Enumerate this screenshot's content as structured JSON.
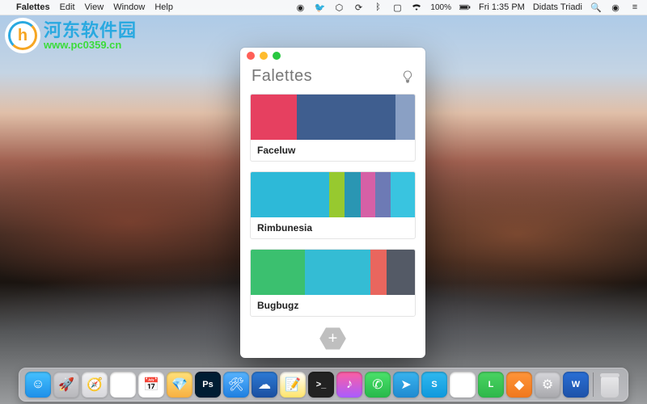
{
  "menubar": {
    "apple": "",
    "appname": "Falettes",
    "items": [
      "Edit",
      "View",
      "Window",
      "Help"
    ],
    "battery": "100%",
    "clock": "Fri 1:35 PM",
    "user": "Didats Triadi"
  },
  "watermark": {
    "logo_letter": "h",
    "cn": "河东软件园",
    "url": "www.pc0359.cn"
  },
  "app": {
    "title": "Falettes",
    "add_label": "+",
    "palettes": [
      {
        "name": "Faceluw",
        "colors": [
          [
            "#e64060",
            28
          ],
          [
            "#3f5e8f",
            60
          ],
          [
            "#8aa0c4",
            12
          ]
        ]
      },
      {
        "name": "Rimbunesia",
        "colors": [
          [
            "#2db9d8",
            48
          ],
          [
            "#97c92f",
            9
          ],
          [
            "#2a96b3",
            10
          ],
          [
            "#d660a6",
            9
          ],
          [
            "#6d7ab5",
            9
          ],
          [
            "#39c4e0",
            15
          ]
        ]
      },
      {
        "name": "Bugbugz",
        "colors": [
          [
            "#3bc06f",
            33
          ],
          [
            "#34bcd4",
            40
          ],
          [
            "#e9665e",
            10
          ],
          [
            "#545a66",
            17
          ]
        ]
      }
    ]
  },
  "dock": {
    "apps": [
      {
        "name": "finder",
        "bg": "linear-gradient(#46c2ff,#1e8fe8)",
        "glyph": "☺"
      },
      {
        "name": "launchpad",
        "bg": "linear-gradient(#d8d8dc,#b8b8bc)",
        "glyph": "🚀"
      },
      {
        "name": "safari",
        "bg": "linear-gradient(#f4f4f6,#d8d8dc)",
        "glyph": "🧭"
      },
      {
        "name": "chrome",
        "bg": "#fff",
        "glyph": "◉"
      },
      {
        "name": "calendar",
        "bg": "#fff",
        "glyph": "📅"
      },
      {
        "name": "sketch",
        "bg": "linear-gradient(#ffe27a,#f7b042)",
        "glyph": "💎"
      },
      {
        "name": "photoshop",
        "bg": "#001d33",
        "glyph": "Ps"
      },
      {
        "name": "xcode",
        "bg": "linear-gradient(#58b4ff,#1f7fe0)",
        "glyph": "🛠"
      },
      {
        "name": "sourcetree",
        "bg": "linear-gradient(#2d7bd6,#1b4fa0)",
        "glyph": "☁"
      },
      {
        "name": "notes",
        "bg": "linear-gradient(#fff,#ffe46b)",
        "glyph": "📝"
      },
      {
        "name": "terminal",
        "bg": "#222",
        "glyph": ">_"
      },
      {
        "name": "itunes",
        "bg": "linear-gradient(#ff5ea0,#a95cff)",
        "glyph": "♪"
      },
      {
        "name": "whatsapp",
        "bg": "linear-gradient(#4be36b,#27b84a)",
        "glyph": "✆"
      },
      {
        "name": "telegram",
        "bg": "linear-gradient(#3ab4ef,#1f8ad0)",
        "glyph": "➤"
      },
      {
        "name": "skype",
        "bg": "linear-gradient(#2fb9f0,#1099dc)",
        "glyph": "S"
      },
      {
        "name": "slack",
        "bg": "#fff",
        "glyph": "✱"
      },
      {
        "name": "line",
        "bg": "linear-gradient(#4ad462,#2eb74a)",
        "glyph": "L"
      },
      {
        "name": "cornerstone",
        "bg": "linear-gradient(#ff953a,#f0781e)",
        "glyph": "◆"
      },
      {
        "name": "prefs",
        "bg": "linear-gradient(#d8d8dc,#a8a8ac)",
        "glyph": "⚙"
      },
      {
        "name": "word",
        "bg": "linear-gradient(#2a6fd6,#1e52a8)",
        "glyph": "W"
      }
    ]
  }
}
